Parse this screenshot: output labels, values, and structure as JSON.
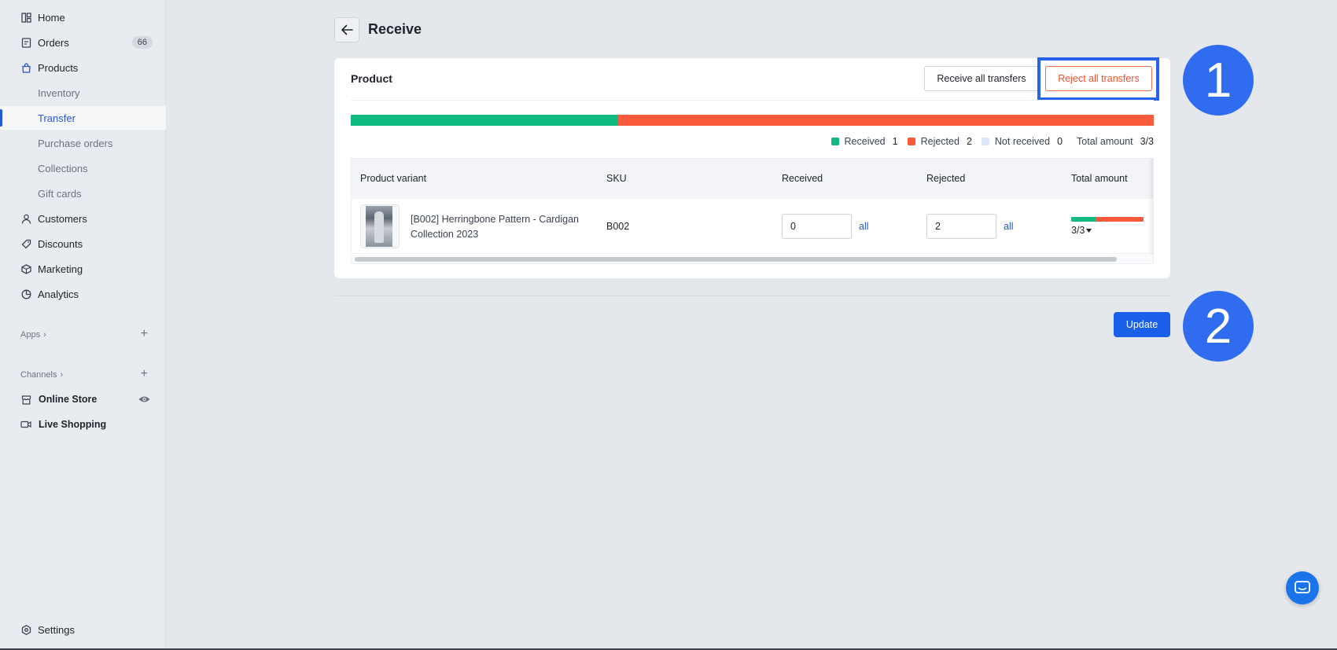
{
  "sidebar": {
    "home": "Home",
    "orders": "Orders",
    "orders_badge": "66",
    "products": "Products",
    "inventory": "Inventory",
    "transfer": "Transfer",
    "purchase_orders": "Purchase orders",
    "collections": "Collections",
    "gift_cards": "Gift cards",
    "customers": "Customers",
    "discounts": "Discounts",
    "marketing": "Marketing",
    "analytics": "Analytics",
    "apps": "Apps",
    "channels": "Channels",
    "online_store": "Online Store",
    "live_shopping": "Live Shopping",
    "settings": "Settings"
  },
  "header": {
    "title": "Receive"
  },
  "card": {
    "title": "Product",
    "receive_all_label": "Receive all transfers",
    "reject_all_label": "Reject all transfers",
    "progress": {
      "received": 1,
      "rejected": 2,
      "not_received": 0,
      "total": 3
    },
    "legend": {
      "received_label": "Received",
      "received_count": "1",
      "rejected_label": "Rejected",
      "rejected_count": "2",
      "not_received_label": "Not received",
      "not_received_count": "0",
      "total_label": "Total amount",
      "total_value": "3/3"
    },
    "table": {
      "columns": [
        "Product variant",
        "SKU",
        "Received",
        "Rejected",
        "Total amount"
      ],
      "rows": [
        {
          "product": "[B002] Herringbone Pattern - Cardigan Collection 2023",
          "sku": "B002",
          "received": "0",
          "rejected": "2",
          "all_label": "all",
          "total": "3/3"
        }
      ]
    }
  },
  "update_label": "Update",
  "markers": {
    "one": "1",
    "two": "2"
  },
  "colors": {
    "accent": "#1a5fe8",
    "received": "#10b981",
    "rejected": "#fa5a3c",
    "not_received": "#dbe6f6",
    "highlight": "#2563eb"
  }
}
